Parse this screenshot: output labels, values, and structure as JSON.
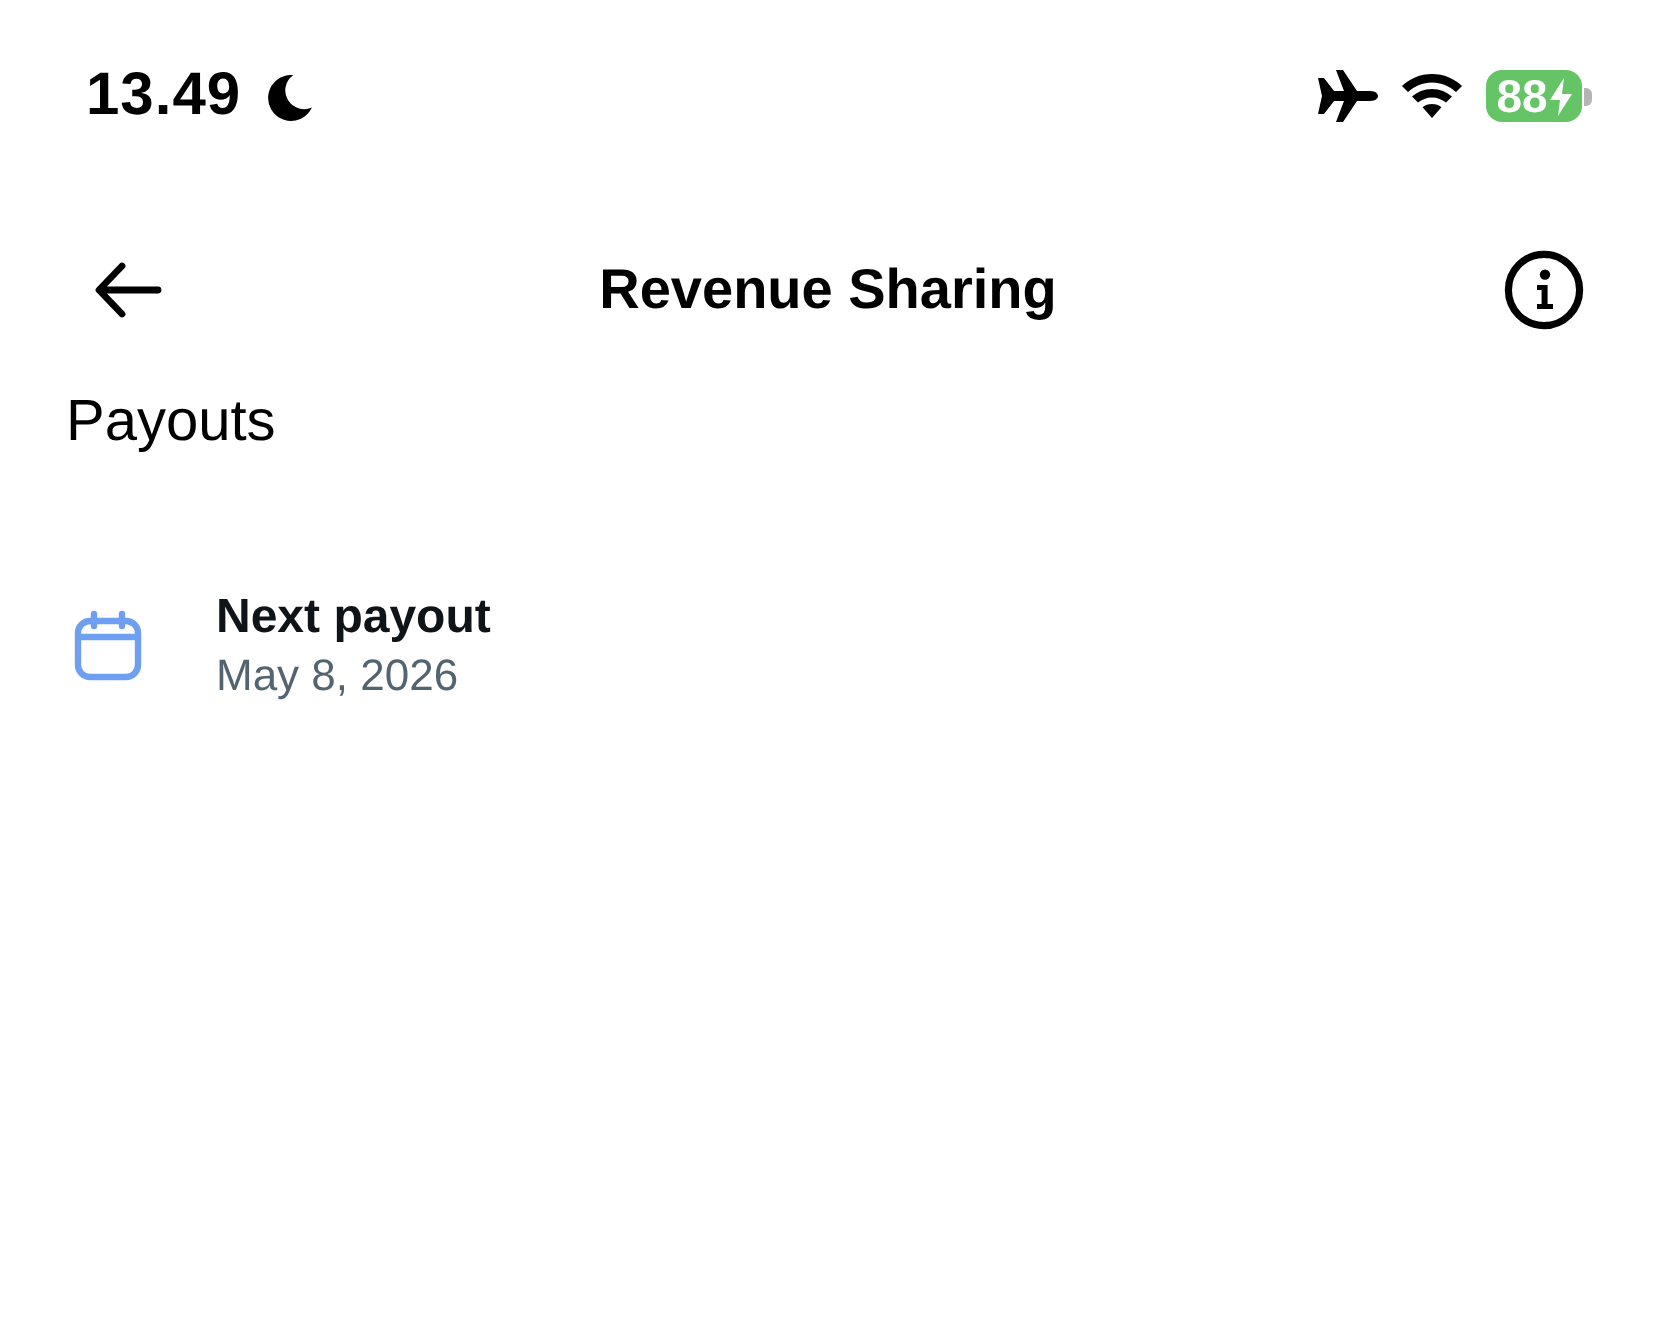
{
  "status_bar": {
    "time": "13.49",
    "do_not_disturb": true,
    "airplane_mode": true,
    "battery": {
      "percent": "88",
      "charging": true
    }
  },
  "header": {
    "title": "Revenue Sharing"
  },
  "section": {
    "title": "Payouts"
  },
  "items": [
    {
      "kind": "calendar",
      "title": "Next payout",
      "subtitle": "May 8, 2026"
    }
  ]
}
